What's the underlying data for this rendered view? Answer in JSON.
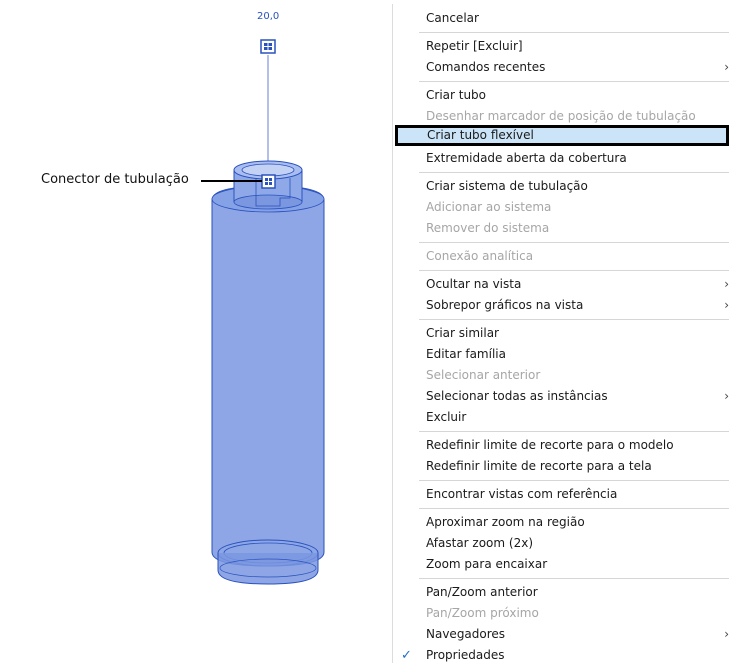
{
  "canvas": {
    "dimension_label": "20,0",
    "callout_label": "Conector de tubulação"
  },
  "context_menu": {
    "items": [
      {
        "label": "Cancelar",
        "enabled": true
      },
      {
        "label": "Repetir [Excluir]",
        "enabled": true
      },
      {
        "label": "Comandos recentes",
        "enabled": true,
        "submenu": true
      },
      {
        "label": "Criar tubo",
        "enabled": true
      },
      {
        "label": "Desenhar marcador de posição de tubulação",
        "enabled": false
      },
      {
        "label": "Criar tubo flexível",
        "enabled": true,
        "highlighted": true
      },
      {
        "label": "Extremidade aberta da cobertura",
        "enabled": true
      },
      {
        "label": "Criar sistema de tubulação",
        "enabled": true
      },
      {
        "label": "Adicionar ao sistema",
        "enabled": false
      },
      {
        "label": "Remover do sistema",
        "enabled": false
      },
      {
        "label": "Conexão analítica",
        "enabled": false
      },
      {
        "label": "Ocultar na vista",
        "enabled": true,
        "submenu": true
      },
      {
        "label": "Sobrepor gráficos na vista",
        "enabled": true,
        "submenu": true
      },
      {
        "label": "Criar similar",
        "enabled": true
      },
      {
        "label": "Editar família",
        "enabled": true
      },
      {
        "label": "Selecionar anterior",
        "enabled": false
      },
      {
        "label": "Selecionar todas as instâncias",
        "enabled": true,
        "submenu": true
      },
      {
        "label": "Excluir",
        "enabled": true
      },
      {
        "label": "Redefinir limite de recorte para o modelo",
        "enabled": true
      },
      {
        "label": "Redefinir limite de recorte para a tela",
        "enabled": true
      },
      {
        "label": "Encontrar vistas com referência",
        "enabled": true
      },
      {
        "label": "Aproximar zoom na região",
        "enabled": true
      },
      {
        "label": "Afastar zoom (2x)",
        "enabled": true
      },
      {
        "label": "Zoom para encaixar",
        "enabled": true
      },
      {
        "label": "Pan/Zoom anterior",
        "enabled": true
      },
      {
        "label": "Pan/Zoom próximo",
        "enabled": false
      },
      {
        "label": "Navegadores",
        "enabled": true,
        "submenu": true
      },
      {
        "label": "Propriedades",
        "enabled": true,
        "checked": true
      }
    ]
  },
  "colors": {
    "highlight": "#cce4f7",
    "disabled_text": "#a6a6a6",
    "model_fill": "#7a97e0",
    "model_stroke": "#2a52be"
  }
}
